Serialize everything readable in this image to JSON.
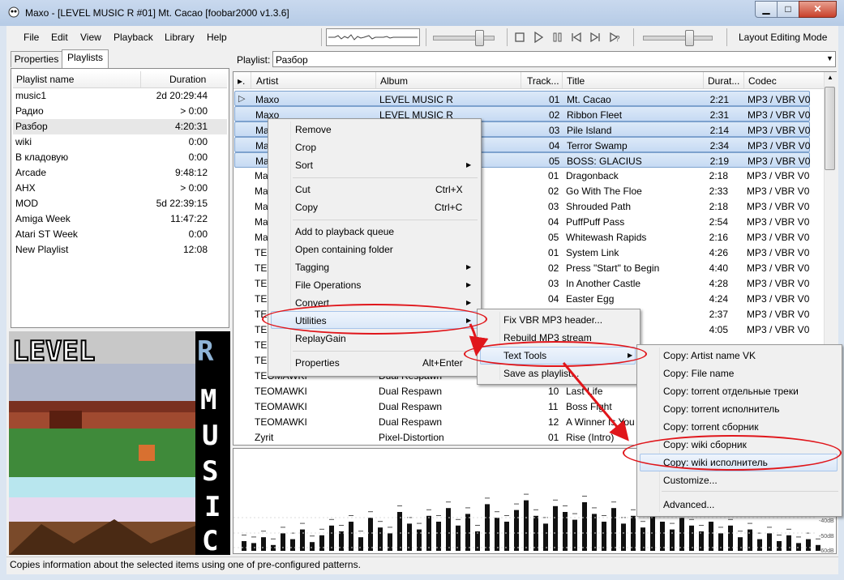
{
  "window": {
    "title": "Maxo - [LEVEL MUSIC R #01] Mt. Cacao  [foobar2000 v1.3.6]",
    "min": "▁",
    "max": "□",
    "close": "✕"
  },
  "menubar": [
    "File",
    "Edit",
    "View",
    "Playback",
    "Library",
    "Help"
  ],
  "toolbar": {
    "buttons": [
      "stop-icon",
      "play-icon",
      "pause-icon",
      "previous-icon",
      "next-icon",
      "random-icon"
    ],
    "layout_mode": "Layout Editing Mode",
    "volume_level": 0.85,
    "seek_level": 0.75
  },
  "left_tabs": [
    "Properties",
    "Playlists"
  ],
  "playlists": {
    "headers": [
      "Playlist name",
      "Duration"
    ],
    "rows": [
      [
        "music1",
        "2d 20:29:44"
      ],
      [
        "Радио",
        "> 0:00"
      ],
      [
        "Разбор",
        "4:20:31"
      ],
      [
        "wiki",
        "0:00"
      ],
      [
        "В кладовую",
        "0:00"
      ],
      [
        "Arcade",
        "9:48:12"
      ],
      [
        "AHX",
        "> 0:00"
      ],
      [
        "MOD",
        "5d 22:39:15"
      ],
      [
        "Amiga Week",
        "11:47:22"
      ],
      [
        "Atari ST Week",
        "0:00"
      ],
      [
        "New Playlist",
        "12:08"
      ]
    ],
    "selected": 2
  },
  "playlist_selector": {
    "label": "Playlist:",
    "value": "Разбор"
  },
  "tracklist": {
    "headers": [
      "Artist",
      "Album",
      "Track...",
      "Title",
      "Durat...",
      "Codec"
    ],
    "rows": [
      [
        "Maxo",
        "LEVEL MUSIC R",
        "01",
        "Mt. Cacao",
        "2:21",
        "MP3 / VBR V0"
      ],
      [
        "Maxo",
        "LEVEL MUSIC R",
        "02",
        "Ribbon Fleet",
        "2:31",
        "MP3 / VBR V0"
      ],
      [
        "Ma",
        "",
        "03",
        "Pile Island",
        "2:14",
        "MP3 / VBR V0"
      ],
      [
        "Ma",
        "",
        "04",
        "Terror Swamp",
        "2:34",
        "MP3 / VBR V0"
      ],
      [
        "Ma",
        "",
        "05",
        "BOSS: GLACIUS",
        "2:19",
        "MP3 / VBR V0"
      ],
      [
        "Ma",
        "",
        "01",
        "Dragonback",
        "2:18",
        "MP3 / VBR V0"
      ],
      [
        "Ma",
        "",
        "02",
        "Go With The Floe",
        "2:33",
        "MP3 / VBR V0"
      ],
      [
        "Ma",
        "",
        "03",
        "Shrouded Path",
        "2:18",
        "MP3 / VBR V0"
      ],
      [
        "Ma",
        "",
        "04",
        "PuffPuff Pass",
        "2:54",
        "MP3 / VBR V0"
      ],
      [
        "Ma",
        "",
        "05",
        "Whitewash Rapids",
        "2:16",
        "MP3 / VBR V0"
      ],
      [
        "TE",
        "",
        "01",
        "System Link",
        "4:26",
        "MP3 / VBR V0"
      ],
      [
        "TE",
        "",
        "02",
        "Press \"Start\" to Begin",
        "4:40",
        "MP3 / VBR V0"
      ],
      [
        "TE",
        "",
        "03",
        "In Another Castle",
        "4:28",
        "MP3 / VBR V0"
      ],
      [
        "TE",
        "",
        "04",
        "Easter Egg",
        "4:24",
        "MP3 / VBR V0"
      ],
      [
        "TE",
        "",
        "",
        "",
        "2:37",
        "MP3 / VBR V0"
      ],
      [
        "TE",
        "",
        "",
        "",
        "4:05",
        "MP3 / VBR V0"
      ],
      [
        "TE",
        "",
        "",
        "",
        "",
        ""
      ],
      [
        "TE",
        "",
        "",
        "",
        "",
        ""
      ],
      [
        "TEOMAWKI",
        "Dual Respawn",
        "",
        "",
        "",
        ""
      ],
      [
        "TEOMAWKI",
        "Dual Respawn",
        "10",
        "Last Life",
        "",
        ""
      ],
      [
        "TEOMAWKI",
        "Dual Respawn",
        "11",
        "Boss Fight",
        "",
        ""
      ],
      [
        "TEOMAWKI",
        "Dual Respawn",
        "12",
        "A Winner Is You",
        "",
        ""
      ],
      [
        "Zyrit",
        "Pixel-Distortion",
        "01",
        "Rise (Intro)",
        "",
        ""
      ]
    ],
    "selected_rows": [
      0,
      1,
      2,
      3,
      4
    ],
    "playing_row": 0
  },
  "context_menu": {
    "items": [
      "Remove",
      "Crop",
      "Sort",
      "Cut",
      "Copy",
      "Add to playback queue",
      "Open containing folder",
      "Tagging",
      "File Operations",
      "Convert",
      "Utilities",
      "ReplayGain",
      "Properties"
    ],
    "shortcuts": {
      "cut": "Ctrl+X",
      "copy": "Ctrl+C",
      "properties": "Alt+Enter"
    }
  },
  "utilities_menu": [
    "Fix VBR MP3 header...",
    "Rebuild MP3 stream",
    "Text Tools",
    "Save as playlist..."
  ],
  "text_tools_menu": [
    "Copy: Artist name VK",
    "Copy: File name",
    "Copy: torrent отдельные треки",
    "Copy: torrent исполнитель",
    "Copy: torrent сборник",
    "Copy: wiki сборник",
    "Copy: wiki исполнитель",
    "Customize...",
    "Advanced..."
  ],
  "spectrum": {
    "db_labels": [
      "-40dB",
      "-50dB",
      "-60dB"
    ]
  },
  "album_art": {
    "letters_top": "LEVEL",
    "letter_r": "R",
    "letters_side": "MUSIC"
  },
  "status": "Copies information about the selected items using one of pre-configured patterns.",
  "colors": {
    "highlight": "#e0161b",
    "selection": "#c6daf3",
    "titlebar": "#b6cbe6"
  }
}
